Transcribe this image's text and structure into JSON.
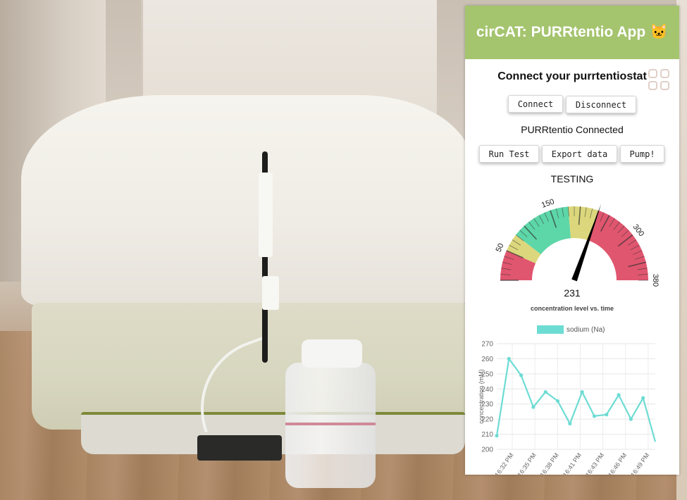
{
  "app": {
    "title": "cirCAT: PURRtentio App 🐱",
    "section_title": "Connect your purrtentiostat",
    "connect_label": "Connect",
    "disconnect_label": "Disconnect",
    "status_text": "PURRtentio Connected",
    "run_test_label": "Run Test",
    "export_label": "Export data",
    "pump_label": "Pump!",
    "test_status": "TESTING",
    "header_color": "#a4c46e"
  },
  "gauge": {
    "value": 231,
    "value_label": "231",
    "min": 0,
    "max": 380,
    "tick_labels": [
      "50",
      "150",
      "300",
      "380"
    ],
    "tick_values": [
      50,
      150,
      300,
      380
    ],
    "segments": [
      {
        "from": 0,
        "to": 50,
        "color": "#e0566f"
      },
      {
        "from": 50,
        "to": 80,
        "color": "#dcd77c"
      },
      {
        "from": 80,
        "to": 180,
        "color": "#5dd6a8"
      },
      {
        "from": 180,
        "to": 230,
        "color": "#dcd77c"
      },
      {
        "from": 230,
        "to": 380,
        "color": "#e0566f"
      }
    ]
  },
  "chart_caption": "concentration level vs. time",
  "chart_data": {
    "type": "line",
    "title": "concentration level vs. time",
    "ylabel": "concentration (mM)",
    "xlabel": "",
    "ylim": [
      200,
      270
    ],
    "yticks": [
      200,
      210,
      220,
      230,
      240,
      250,
      260,
      270
    ],
    "xticks": [
      "16:32 PM",
      "16:35 PM",
      "16:38 PM",
      "16:41 PM",
      "16:43 PM",
      "16:46 PM",
      "16:49 PM"
    ],
    "grid": true,
    "legend": "top",
    "series": [
      {
        "name": "sodium (Na)",
        "color": "#6ddcd3",
        "values": [
          209,
          260,
          249,
          228,
          238,
          232,
          217,
          238,
          222,
          223,
          236,
          220,
          234,
          205
        ]
      }
    ]
  }
}
